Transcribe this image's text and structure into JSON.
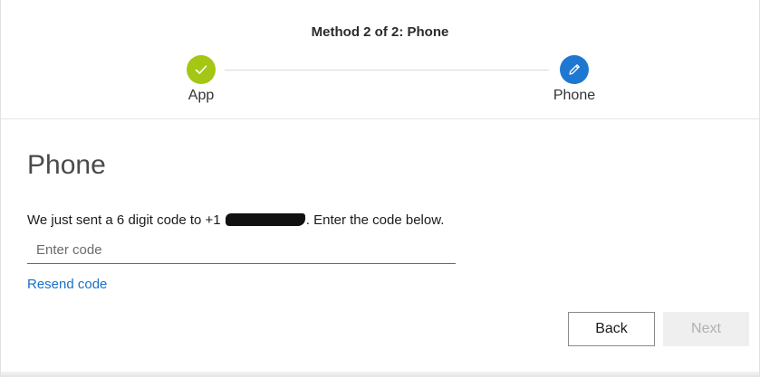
{
  "stepper": {
    "title": "Method 2 of 2: Phone",
    "steps": [
      {
        "label": "App",
        "state": "complete",
        "icon": "checkmark-icon",
        "color": "#a4c614"
      },
      {
        "label": "Phone",
        "state": "current",
        "icon": "pencil-icon",
        "color": "#1e78d2"
      }
    ]
  },
  "content": {
    "title": "Phone",
    "instruction_prefix": "We just sent a 6 digit code to +1 ",
    "instruction_suffix": ". Enter the code below.",
    "code_input": {
      "placeholder": "Enter code",
      "value": ""
    },
    "resend_label": "Resend code"
  },
  "actions": {
    "back_label": "Back",
    "next_label": "Next"
  },
  "colors": {
    "link": "#1a6fc9",
    "complete": "#a4c614",
    "current": "#1e78d2"
  }
}
